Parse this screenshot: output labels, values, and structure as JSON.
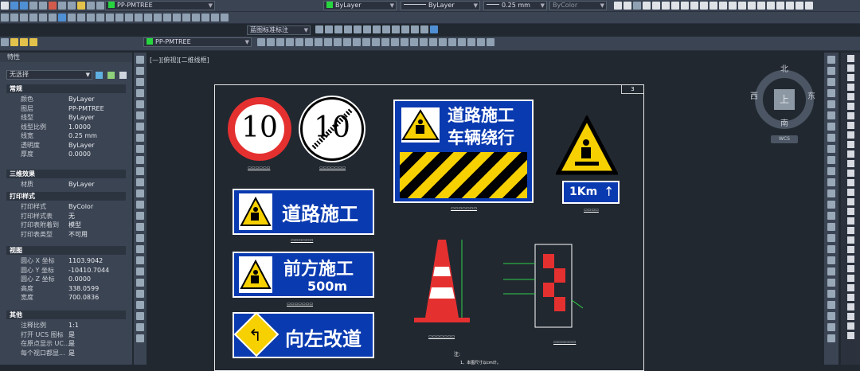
{
  "toolbar": {
    "layer_current": "PP-PMTREE",
    "color_value": "ByLayer",
    "linetype_value": "ByLayer",
    "lineweight_value": "0.25 mm",
    "plotstyle_value": "ByColor",
    "annotation_style": "蓝图标准标注",
    "layer_current_2": "PP-PMTREE"
  },
  "palette": {
    "title": "特性",
    "selection": "无选择",
    "categories": {
      "general": "常规",
      "three_d": "三维效果",
      "plot": "打印样式",
      "view": "视图",
      "misc": "其他"
    },
    "general_rows": [
      {
        "k": "颜色",
        "v": "ByLayer"
      },
      {
        "k": "图层",
        "v": "PP-PMTREE"
      },
      {
        "k": "线型",
        "v": "ByLayer"
      },
      {
        "k": "线型比例",
        "v": "1.0000"
      },
      {
        "k": "线宽",
        "v": "0.25 mm"
      },
      {
        "k": "透明度",
        "v": "ByLayer"
      },
      {
        "k": "厚度",
        "v": "0.0000"
      }
    ],
    "three_d_rows": [
      {
        "k": "材质",
        "v": "ByLayer"
      }
    ],
    "plot_rows": [
      {
        "k": "打印样式",
        "v": "ByColor"
      },
      {
        "k": "打印样式表",
        "v": "无"
      },
      {
        "k": "打印表附着到",
        "v": "模型"
      },
      {
        "k": "打印表类型",
        "v": "不可用"
      }
    ],
    "view_rows": [
      {
        "k": "圆心 X 坐标",
        "v": "1103.9042"
      },
      {
        "k": "圆心 Y 坐标",
        "v": "-10410.7044"
      },
      {
        "k": "圆心 Z 坐标",
        "v": "0.0000"
      },
      {
        "k": "高度",
        "v": "338.0599"
      },
      {
        "k": "宽度",
        "v": "700.0836"
      }
    ],
    "misc_rows": [
      {
        "k": "注释比例",
        "v": "1:1"
      },
      {
        "k": "打开 UCS 图标",
        "v": "是"
      },
      {
        "k": "在原点显示 UC...",
        "v": "是"
      },
      {
        "k": "每个视口都显...",
        "v": "是"
      }
    ]
  },
  "viewport_label": "[—][俯视][二维线框]",
  "compass": {
    "north": "北",
    "south": "南",
    "east": "东",
    "west": "西",
    "center": "上",
    "wcs": "WCS"
  },
  "drawing": {
    "sheet_number": "3",
    "speed10": "10",
    "end10": "10",
    "sign_road_work": "道路施工",
    "sign_detour_1": "道路施工",
    "sign_detour_2": "车辆绕行",
    "sign_ahead": "前方施工",
    "sign_ahead_dist": "500m",
    "sign_left": "向左改道",
    "sign_km": "1Km",
    "note_title": "注:",
    "note_1": "1、本图尺寸以cm计。"
  }
}
